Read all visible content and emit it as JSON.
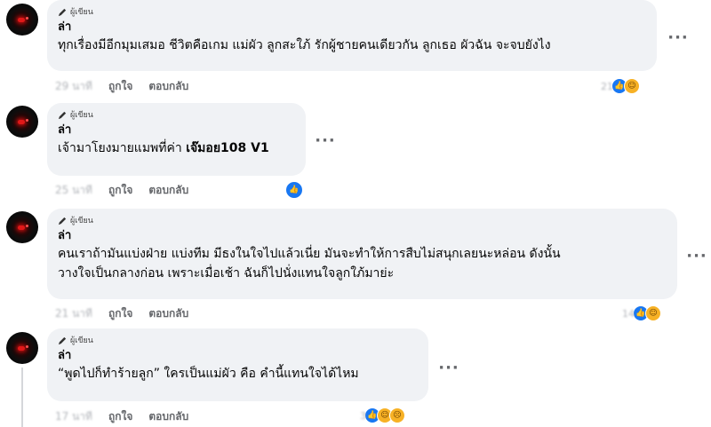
{
  "comments": [
    {
      "badge": "ผู้เขียน",
      "author": "ล่า",
      "lines": [
        "ทุกเรื่องมีอีกมุมเสมอ ชีวิตคือเกม แม่ผัว ลูกสะใภ้ รักผู้ชายคนเดียวกัน ลูกเธอ ผัวฉัน จะจบยังไง"
      ],
      "time": "29 นาที",
      "like_label": "ถูกใจ",
      "reply_label": "ตอบกลับ",
      "reaction_count": "21",
      "reactions": [
        "like-icon",
        "haha-icon"
      ]
    },
    {
      "badge": "ผู้เขียน",
      "author": "ล่า",
      "text_plain": "เจ้ามาโยงมายแมพที่ค่า ",
      "text_mention": "เจ๊มอย108 V1",
      "time": "25 นาที",
      "like_label": "ถูกใจ",
      "reply_label": "ตอบกลับ",
      "reactions": [
        "like-icon"
      ]
    },
    {
      "badge": "ผู้เขียน",
      "author": "ล่า",
      "lines": [
        "คนเราถ้ามันแบ่งฝ่าย แบ่งทีม มีธงในใจไปแล้วเนี่ย มันจะทำให้การสืบไม่สนุกเลยนะหล่อน ดังนั้น",
        "วางใจเป็นกลางก่อน เพราะเมื่อเช้า ฉันก็ไปนั่งแทนใจลูกใภ้มาย่ะ"
      ],
      "time": "21 นาที",
      "like_label": "ถูกใจ",
      "reply_label": "ตอบกลับ",
      "reaction_count": "14",
      "reactions": [
        "like-icon",
        "haha-icon"
      ]
    },
    {
      "badge": "ผู้เขียน",
      "author": "ล่า",
      "lines": [
        "“พูดไปก็ทำร้ายลูก” ใครเป็นแม่ผัว คือ คำนี้แทนใจได้ไหม"
      ],
      "time": "17 นาที",
      "like_label": "ถูกใจ",
      "reply_label": "ตอบกลับ",
      "reaction_count": "3",
      "reactions": [
        "like-icon",
        "haha-icon",
        "sad-icon"
      ]
    }
  ],
  "more_label": "···"
}
